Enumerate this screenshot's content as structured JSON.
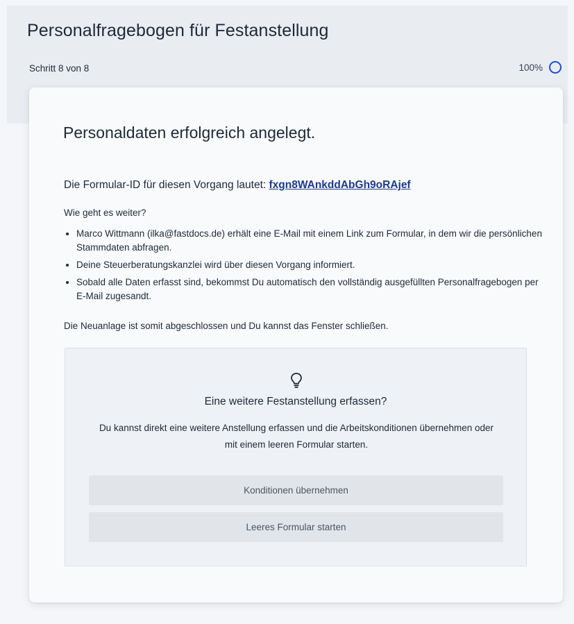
{
  "header": {
    "title": "Personalfragebogen für Festanstellung",
    "step": "Schritt 8 von 8",
    "progress": "100%",
    "progress_fraction": 1.0,
    "accent_color": "#1d4ed8"
  },
  "card": {
    "heading": "Personaldaten erfolgreich angelegt.",
    "form_id_prefix": "Die Formular-ID für diesen Vorgang lautet:",
    "form_id": "fxgn8WAnkddAbGh9oRAjef",
    "next_label": "Wie geht es weiter?",
    "next_items": [
      "Marco Wittmann (ilka@fastdocs.de) erhält eine E-Mail mit einem Link zum Formular, in dem wir die persönlichen Stammdaten abfragen.",
      "Deine Steuerberatungskanzlei wird über diesen Vorgang informiert.",
      "Sobald alle Daten erfasst sind, bekommst Du automatisch den vollständig ausgefüllten Personalfragebogen per E-Mail zugesandt."
    ],
    "done_text": "Die Neuanlage ist somit abgeschlossen und Du kannst das Fenster schließen."
  },
  "another": {
    "icon": "lightbulb-icon",
    "heading": "Eine weitere Festanstellung erfassen?",
    "text": "Du kannst direkt eine weitere Anstellung erfassen und die Arbeitskonditionen übernehmen oder mit einem leeren Formular starten.",
    "keep_button": "Konditionen übernehmen",
    "empty_button": "Leeres Formular starten"
  }
}
